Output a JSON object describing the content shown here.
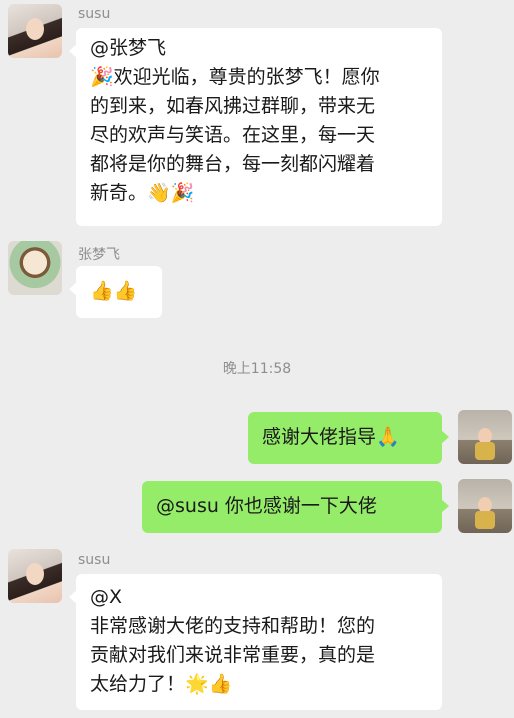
{
  "messages": [
    {
      "sender": "susu",
      "lines": [
        "@张梦飞",
        "🎉欢迎光临，尊贵的张梦飞！愿你",
        "的到来，如春风拂过群聊，带来无",
        "尽的欢声与笑语。在这里，每一天",
        "都将是你的舞台，每一刻都闪耀着",
        "新奇。👋🎉"
      ]
    },
    {
      "sender": "张梦飞",
      "lines": [
        "👍👍"
      ]
    },
    {
      "text": "感谢大佬指导🙏"
    },
    {
      "text": "@susu   你也感谢一下大佬"
    },
    {
      "sender": "susu",
      "lines": [
        "@X",
        "非常感谢大佬的支持和帮助！您的",
        "贡献对我们来说非常重要，真的是",
        "太给力了！🌟👍"
      ]
    }
  ],
  "timestamp": "晚上11:58"
}
